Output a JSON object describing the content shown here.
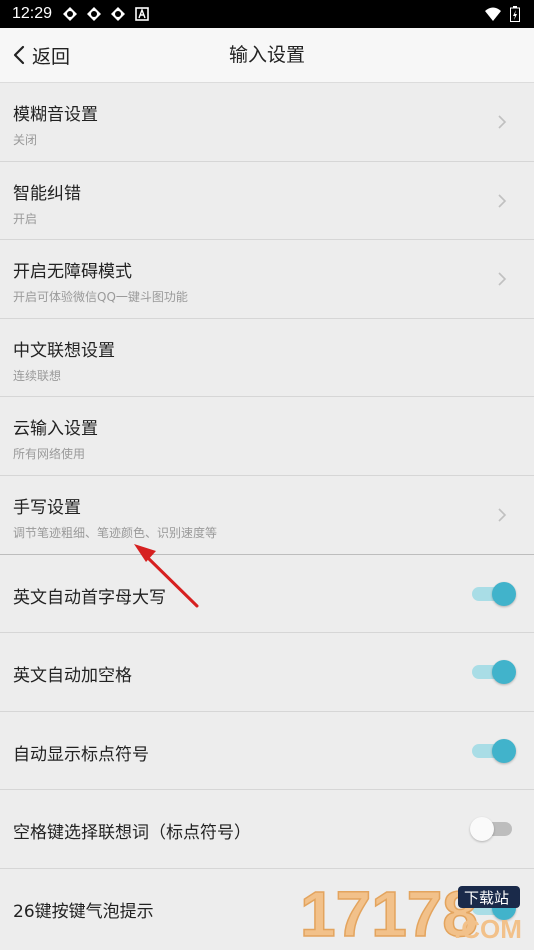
{
  "status_bar": {
    "time": "12:29"
  },
  "nav": {
    "back_label": "返回",
    "title": "输入设置"
  },
  "settings": [
    {
      "title": "模糊音设置",
      "subtitle": "关闭"
    },
    {
      "title": "智能纠错",
      "subtitle": "开启"
    },
    {
      "title": "开启无障碍模式",
      "subtitle": "开启可体验微信QQ一键斗图功能"
    },
    {
      "title": "中文联想设置",
      "subtitle": "连续联想"
    },
    {
      "title": "云输入设置",
      "subtitle": "所有网络使用"
    },
    {
      "title": "手写设置",
      "subtitle": "调节笔迹粗细、笔迹颜色、识别速度等"
    }
  ],
  "toggles": [
    {
      "title": "英文自动首字母大写",
      "on": true
    },
    {
      "title": "英文自动加空格",
      "on": true
    },
    {
      "title": "自动显示标点符号",
      "on": true
    },
    {
      "title": "空格键选择联想词（标点符号）",
      "on": false
    },
    {
      "title": "26键按键气泡提示",
      "on": true
    }
  ],
  "watermark": {
    "number": "17178",
    "domain": ".COM",
    "badge": "下载站"
  },
  "colors": {
    "accent": "#41b3cb",
    "arrow": "#d62020"
  }
}
